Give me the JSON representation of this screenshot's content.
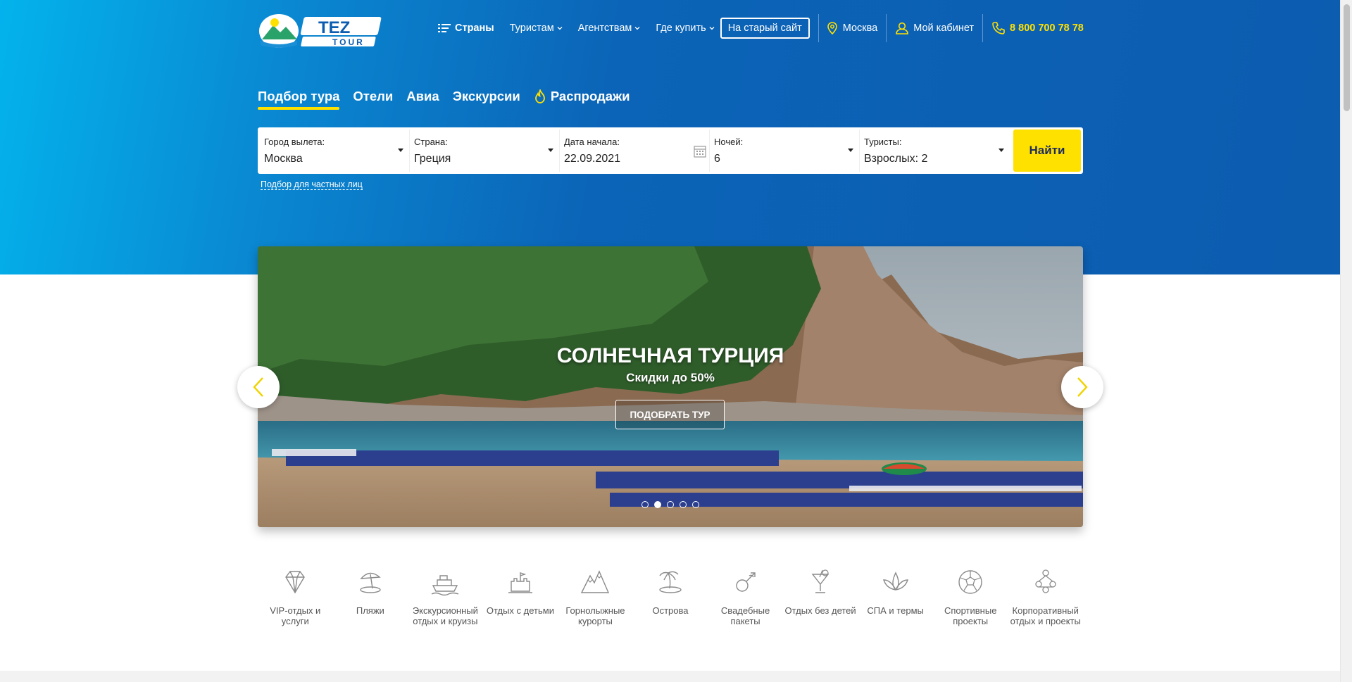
{
  "logo": {
    "text_top": "TEZ",
    "text_bottom": "TOUR"
  },
  "nav": {
    "countries": "Страны",
    "tourists": "Туристам",
    "agencies": "Агентствам",
    "where_buy": "Где купить",
    "old_site": "На старый сайт",
    "city": "Москва",
    "cabinet": "Мой кабинет",
    "phone": "8 800 700 78 78"
  },
  "tabs": [
    {
      "label": "Подбор тура",
      "active": true
    },
    {
      "label": "Отели"
    },
    {
      "label": "Авиа"
    },
    {
      "label": "Экскурсии"
    },
    {
      "label": "Распродажи"
    }
  ],
  "search": {
    "fields": [
      {
        "label": "Город вылета:",
        "value": "Москва"
      },
      {
        "label": "Страна:",
        "value": "Греция"
      },
      {
        "label": "Дата начала:",
        "value": "22.09.2021"
      },
      {
        "label": "Ночей:",
        "value": "6"
      },
      {
        "label": "Туристы:",
        "value": "Взрослых: 2"
      }
    ],
    "button": "Найти",
    "private_link": "Подбор для частных лиц"
  },
  "slider": {
    "title": "СОЛНЕЧНАЯ ТУРЦИЯ",
    "subtitle": "Скидки до 50%",
    "button": "ПОДОБРАТЬ ТУР",
    "dots": 5,
    "active_dot": 2
  },
  "categories": [
    {
      "label": "VIP-отдых и услуги",
      "icon": "diamond-icon"
    },
    {
      "label": "Пляжи",
      "icon": "beach-umbrella-icon"
    },
    {
      "label": "Экскурсионный отдых и круизы",
      "icon": "ship-icon"
    },
    {
      "label": "Отдых с детьми",
      "icon": "sandcastle-icon"
    },
    {
      "label": "Горнолыжные курорты",
      "icon": "mountains-icon"
    },
    {
      "label": "Острова",
      "icon": "island-icon"
    },
    {
      "label": "Свадебные пакеты",
      "icon": "wedding-icon"
    },
    {
      "label": "Отдых без детей",
      "icon": "cocktail-icon"
    },
    {
      "label": "СПА и термы",
      "icon": "lotus-icon"
    },
    {
      "label": "Спортивные проекты",
      "icon": "soccer-ball-icon"
    },
    {
      "label": "Корпоративный отдых и проекты",
      "icon": "team-icon"
    }
  ],
  "colors": {
    "accent": "#ffe100",
    "hero_blue": "#0c5cb0",
    "hero_light": "#03b3ec"
  }
}
